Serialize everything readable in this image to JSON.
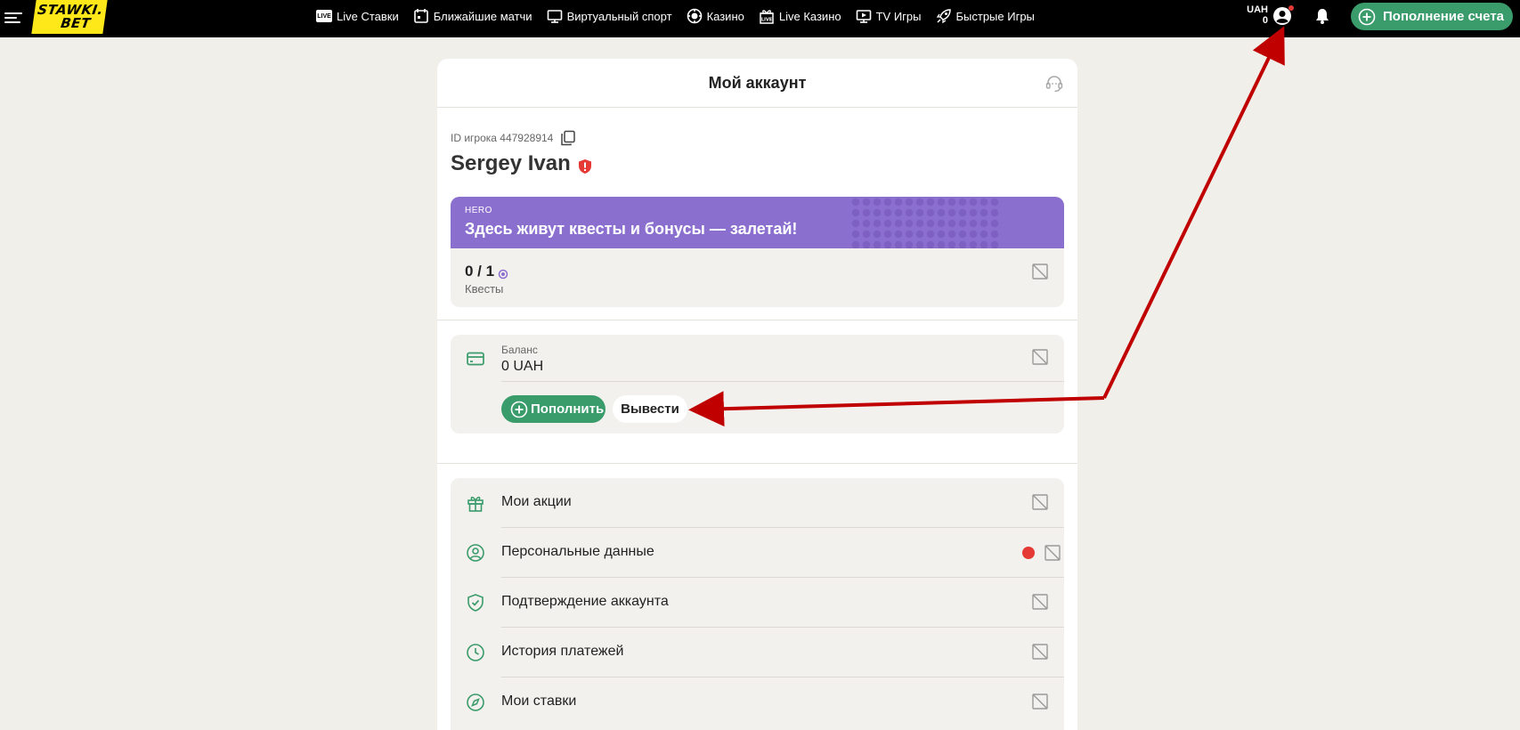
{
  "header": {
    "logo": {
      "line1": "STAWKI.",
      "line2": "BET"
    },
    "nav": [
      {
        "label": "Live Ставки",
        "icon": "live-badge-icon"
      },
      {
        "label": "Ближайшие матчи",
        "icon": "calendar-icon"
      },
      {
        "label": "Виртуальный спорт",
        "icon": "monitor-icon"
      },
      {
        "label": "Казино",
        "icon": "casino-chip-icon"
      },
      {
        "label": "Live Казино",
        "icon": "live-gift-icon"
      },
      {
        "label": "TV Игры",
        "icon": "tv-icon"
      },
      {
        "label": "Быстрые Игры",
        "icon": "rocket-icon"
      }
    ],
    "currency": "UAH",
    "balance": "0",
    "deposit_label": "Пополнение счета"
  },
  "account": {
    "title": "Мой аккаунт",
    "player_id": "ID игрока 447928914",
    "name": "Sergey Ivan"
  },
  "hero": {
    "tag": "HERO",
    "text": "Здесь живут квесты и бонусы — залетай!",
    "quest_count": "0 / 1",
    "quest_label": "Квесты"
  },
  "balance": {
    "label": "Баланс",
    "value": "0 UAH",
    "fill_label": "Пополнить",
    "withdraw_label": "Вывести"
  },
  "menu": [
    {
      "label": "Мои акции",
      "icon": "gift-icon",
      "alert": false
    },
    {
      "label": "Персональные данные",
      "icon": "user-circle-icon",
      "alert": true
    },
    {
      "label": "Подтверждение аккаунта",
      "icon": "shield-check-icon",
      "alert": false
    },
    {
      "label": "История платежей",
      "icon": "clock-icon",
      "alert": false
    },
    {
      "label": "Мои ставки",
      "icon": "compass-icon",
      "alert": false
    }
  ],
  "colors": {
    "accent": "#3a9b6b",
    "hero": "#8b6fcf",
    "alert": "#e53935",
    "arrow": "#c00000"
  }
}
